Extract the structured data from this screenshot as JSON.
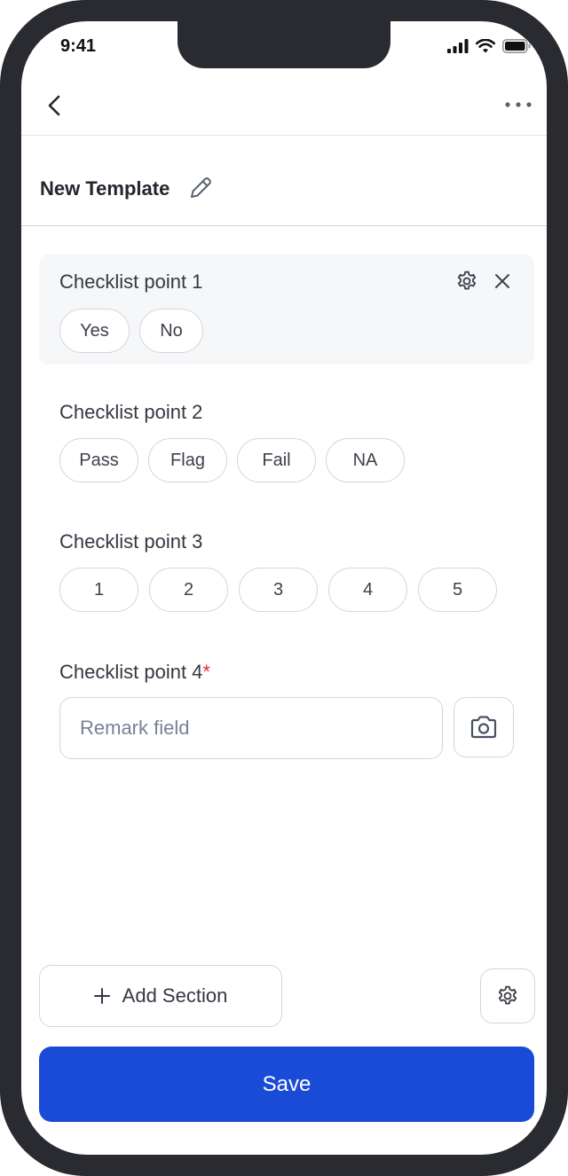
{
  "status_bar": {
    "time": "9:41"
  },
  "nav": {
    "back_icon": "chevron-left-icon",
    "more_icon": "more-horizontal-icon"
  },
  "header": {
    "title": "New Template",
    "edit_icon": "pencil-icon"
  },
  "checklist": {
    "point1": {
      "label": "Checklist point 1",
      "options": [
        "Yes",
        "No"
      ]
    },
    "point2": {
      "label": "Checklist point 2",
      "options": [
        "Pass",
        "Flag",
        "Fail",
        "NA"
      ]
    },
    "point3": {
      "label": "Checklist point 3",
      "options": [
        "1",
        "2",
        "3",
        "4",
        "5"
      ]
    },
    "point4": {
      "label": "Checklist point 4",
      "required_mark": "*",
      "placeholder": "Remark field"
    }
  },
  "footer": {
    "add_section_label": "Add Section",
    "save_label": "Save"
  },
  "colors": {
    "primary": "#1a4bd6",
    "required": "#d9313b",
    "highlight_bg": "#f6f7f9"
  }
}
